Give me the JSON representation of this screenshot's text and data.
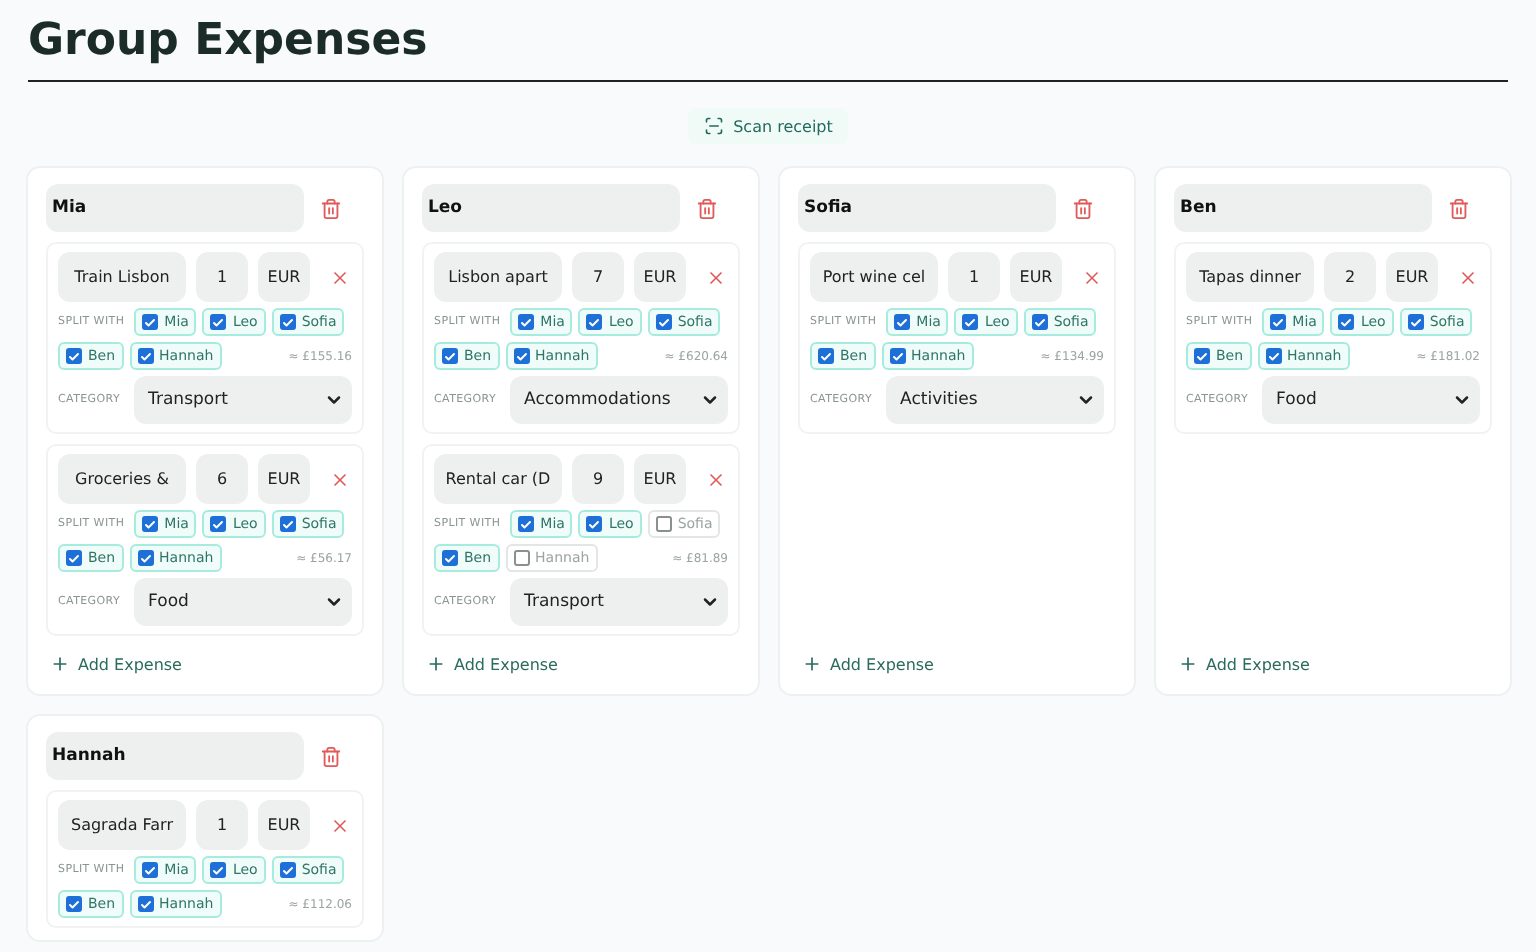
{
  "title": "Group Expenses",
  "scan_button": "Scan receipt",
  "people": [
    {
      "name": "Mia",
      "add_expense": "Add Expense",
      "expenses": [
        {
          "description": "Train Lisbon",
          "amount": "1",
          "currency": "EUR",
          "split_label": "SPLIT WITH",
          "split": [
            {
              "name": "Mia",
              "checked": true
            },
            {
              "name": "Leo",
              "checked": true
            },
            {
              "name": "Sofia",
              "checked": true
            },
            {
              "name": "Ben",
              "checked": true
            },
            {
              "name": "Hannah",
              "checked": true
            }
          ],
          "total": "≈ £155.16",
          "category_label": "CATEGORY",
          "category": "Transport"
        },
        {
          "description": "Groceries &",
          "amount": "6",
          "currency": "EUR",
          "split_label": "SPLIT WITH",
          "split": [
            {
              "name": "Mia",
              "checked": true
            },
            {
              "name": "Leo",
              "checked": true
            },
            {
              "name": "Sofia",
              "checked": true
            },
            {
              "name": "Ben",
              "checked": true
            },
            {
              "name": "Hannah",
              "checked": true
            }
          ],
          "total": "≈ £56.17",
          "category_label": "CATEGORY",
          "category": "Food"
        }
      ]
    },
    {
      "name": "Leo",
      "add_expense": "Add Expense",
      "expenses": [
        {
          "description": "Lisbon apart",
          "amount": "7",
          "currency": "EUR",
          "split_label": "SPLIT WITH",
          "split": [
            {
              "name": "Mia",
              "checked": true
            },
            {
              "name": "Leo",
              "checked": true
            },
            {
              "name": "Sofia",
              "checked": true
            },
            {
              "name": "Ben",
              "checked": true
            },
            {
              "name": "Hannah",
              "checked": true
            }
          ],
          "total": "≈ £620.64",
          "category_label": "CATEGORY",
          "category": "Accommodations"
        },
        {
          "description": "Rental car (D",
          "amount": "9",
          "currency": "EUR",
          "split_label": "SPLIT WITH",
          "split": [
            {
              "name": "Mia",
              "checked": true
            },
            {
              "name": "Leo",
              "checked": true
            },
            {
              "name": "Sofia",
              "checked": false
            },
            {
              "name": "Ben",
              "checked": true
            },
            {
              "name": "Hannah",
              "checked": false
            }
          ],
          "total": "≈ £81.89",
          "category_label": "CATEGORY",
          "category": "Transport"
        }
      ]
    },
    {
      "name": "Sofia",
      "add_expense": "Add Expense",
      "expenses": [
        {
          "description": "Port wine cel",
          "amount": "1",
          "currency": "EUR",
          "split_label": "SPLIT WITH",
          "split": [
            {
              "name": "Mia",
              "checked": true
            },
            {
              "name": "Leo",
              "checked": true
            },
            {
              "name": "Sofia",
              "checked": true
            },
            {
              "name": "Ben",
              "checked": true
            },
            {
              "name": "Hannah",
              "checked": true
            }
          ],
          "total": "≈ £134.99",
          "category_label": "CATEGORY",
          "category": "Activities"
        }
      ]
    },
    {
      "name": "Ben",
      "add_expense": "Add Expense",
      "expenses": [
        {
          "description": "Tapas dinner",
          "amount": "2",
          "currency": "EUR",
          "split_label": "SPLIT WITH",
          "split": [
            {
              "name": "Mia",
              "checked": true
            },
            {
              "name": "Leo",
              "checked": true
            },
            {
              "name": "Sofia",
              "checked": true
            },
            {
              "name": "Ben",
              "checked": true
            },
            {
              "name": "Hannah",
              "checked": true
            }
          ],
          "total": "≈ £181.02",
          "category_label": "CATEGORY",
          "category": "Food"
        }
      ]
    },
    {
      "name": "Hannah",
      "expenses": [
        {
          "description": "Sagrada Farr",
          "amount": "1",
          "currency": "EUR",
          "split_label": "SPLIT WITH",
          "split": [
            {
              "name": "Mia",
              "checked": true
            },
            {
              "name": "Leo",
              "checked": true
            },
            {
              "name": "Sofia",
              "checked": true
            },
            {
              "name": "Ben",
              "checked": true
            },
            {
              "name": "Hannah",
              "checked": true
            }
          ],
          "total": "≈ £112.06"
        }
      ]
    }
  ]
}
